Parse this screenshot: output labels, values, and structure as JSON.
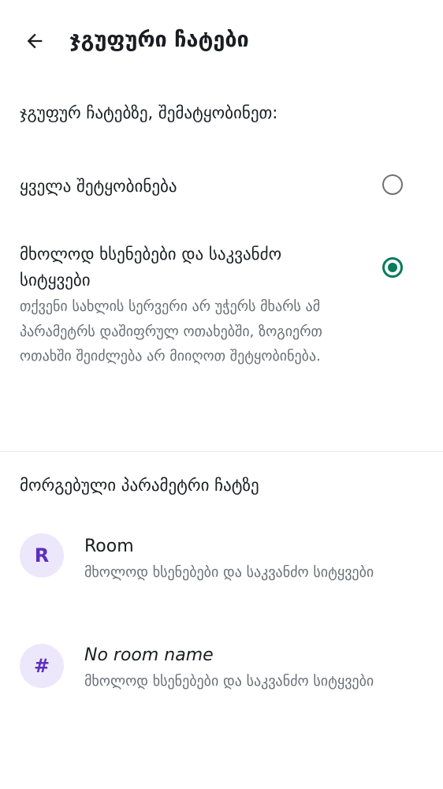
{
  "header": {
    "title": "ჯგუფური ჩატები"
  },
  "group_settings": {
    "section_title": "ჯგუფურ ჩატებზე, შემატყობინეთ:",
    "options": [
      {
        "label": "ყველა შეტყობინება",
        "selected": false
      },
      {
        "label": "მხოლოდ ხსენებები და საკვანძო სიტყვები",
        "description": "თქვენი სახლის სერვერი არ უჭერს მხარს ამ პარამეტრს დაშიფრულ ოთახებში, ზოგიერთ ოთახში შეიძლება არ მიიღოთ შეტყობინება.",
        "selected": true
      }
    ]
  },
  "custom_settings": {
    "section_title": "მორგებული პარამეტრი ჩატზე",
    "rooms": [
      {
        "avatar_letter": "R",
        "name": "Room",
        "setting": "მხოლოდ ხსენებები და საკვანძო სიტყვები"
      },
      {
        "avatar_letter": "#",
        "name": "No room name",
        "setting": "მხოლოდ ხსენებები და საკვანძო სიტყვები"
      }
    ]
  },
  "colors": {
    "accent": "#0a7b57",
    "avatar_bg": "#ede7fb",
    "avatar_fg": "#5a2fc2",
    "secondary_text": "#6a6d75"
  },
  "icons": {
    "back": "arrow-left-icon"
  }
}
